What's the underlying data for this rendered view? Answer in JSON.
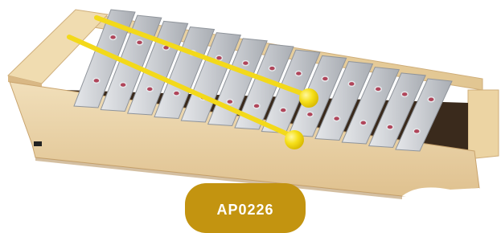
{
  "image": {
    "subject": "metallophone-with-two-mallets",
    "bar_count": 13,
    "colors": {
      "background": "#ffffff",
      "wood_light": "#eed9b0",
      "wood_shade": "#d9b885",
      "bar_metal": "#c9ccd1",
      "bar_edge": "#8f949b",
      "rivet": "#b0455a",
      "mallet_yellow": "#f6e01a",
      "badge": "#c39410"
    }
  },
  "badge": {
    "code": "AP0226"
  }
}
